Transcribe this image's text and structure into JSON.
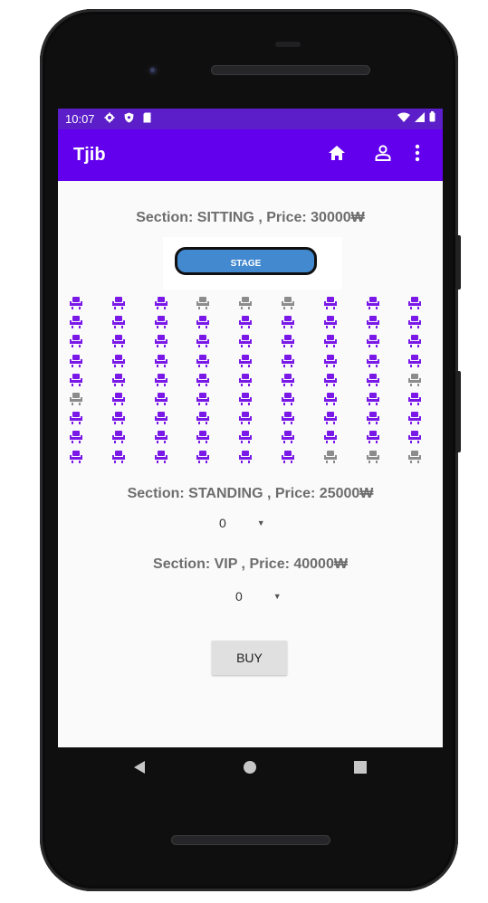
{
  "status_bar": {
    "time": "10:07",
    "left_icons": [
      "gear-icon",
      "shield-icon",
      "sim-icon"
    ],
    "right_icons": [
      "wifi-icon",
      "signal-icon",
      "battery-icon"
    ]
  },
  "app_bar": {
    "title": "Tjib",
    "actions": [
      "home-icon",
      "person-icon",
      "overflow-menu-icon"
    ]
  },
  "colors": {
    "primary": "#6200ee",
    "status_bar": "#5b1ec8",
    "seat_available": "#7a18e8",
    "seat_taken": "#8c8c8c",
    "stage": "#4289cf",
    "button": "#e0e0e0"
  },
  "sitting": {
    "label": "Section: SITTING , Price: 30000₩",
    "stage_label": "STAGE",
    "seat_grid": {
      "columns": 9,
      "rows": 9,
      "taken_note": "1 = available (purple), 0 = taken (gray)",
      "rows_state": [
        [
          1,
          1,
          1,
          0,
          0,
          0,
          1,
          1,
          1
        ],
        [
          1,
          1,
          1,
          1,
          1,
          1,
          1,
          1,
          1
        ],
        [
          1,
          1,
          1,
          1,
          1,
          1,
          1,
          1,
          1
        ],
        [
          1,
          1,
          1,
          1,
          1,
          1,
          1,
          1,
          1
        ],
        [
          1,
          1,
          1,
          1,
          1,
          1,
          1,
          1,
          0
        ],
        [
          0,
          1,
          1,
          1,
          1,
          1,
          1,
          1,
          1
        ],
        [
          1,
          1,
          1,
          1,
          1,
          1,
          1,
          1,
          1
        ],
        [
          1,
          1,
          1,
          1,
          1,
          1,
          1,
          1,
          1
        ],
        [
          1,
          1,
          1,
          1,
          1,
          1,
          0,
          0,
          0
        ]
      ]
    }
  },
  "standing": {
    "label": "Section: STANDING , Price: 25000₩",
    "selected_quantity": "0"
  },
  "vip": {
    "label": "Section: VIP , Price: 40000₩",
    "selected_quantity": "0"
  },
  "buy_button": {
    "label": "BUY"
  },
  "nav_bar": {
    "items": [
      "back-icon",
      "home-circle-icon",
      "recents-icon"
    ]
  }
}
